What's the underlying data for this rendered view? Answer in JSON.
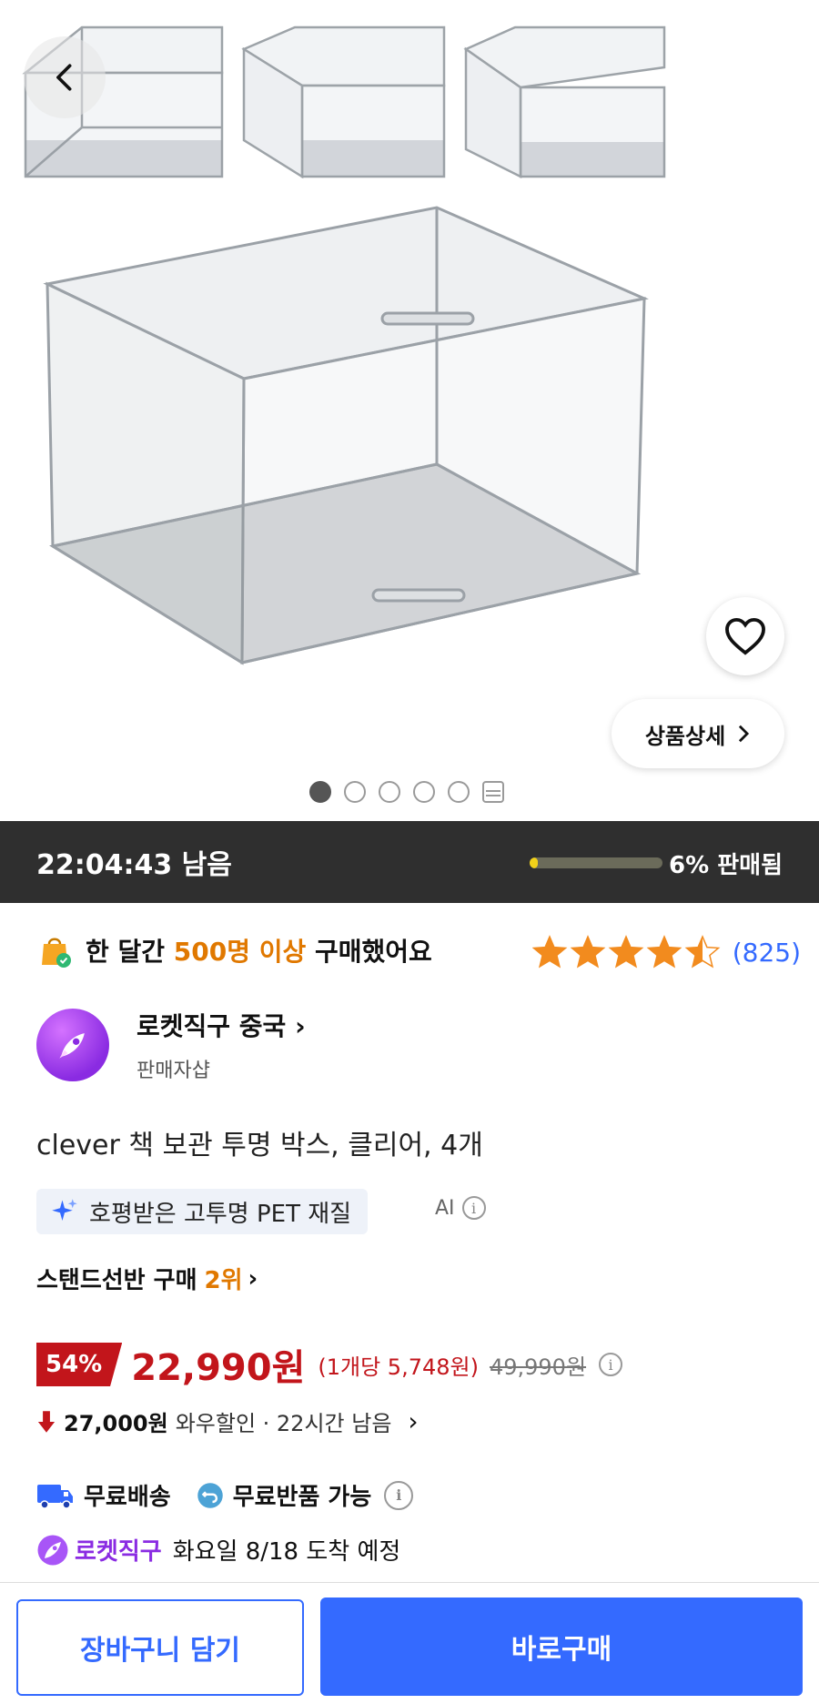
{
  "hero": {
    "back_icon": "chevron-left-icon",
    "wishlist_icon": "heart-icon",
    "detail_label": "상품상세",
    "image_count": 5,
    "active_image": 1
  },
  "timer": {
    "remaining": "22:04:43 남음",
    "sold_fraction": 0.06,
    "sold_label": "6% 판매됨"
  },
  "social_proof": {
    "prefix": "한 달간",
    "highlight": "500명 이상",
    "suffix": "구매했어요"
  },
  "rating": {
    "stars": 4.5,
    "count": "(825)"
  },
  "seller": {
    "name": "로켓직구 중국",
    "sub": "판매자샵"
  },
  "product": {
    "title": "clever 책 보관 투명 박스, 클리어, 4개"
  },
  "ai_summary": {
    "text": "호평받은 고투명 PET 재질",
    "label": "AI"
  },
  "ranking": {
    "text": "스탠드선반 구매",
    "rank": "2위"
  },
  "price": {
    "discount": "54%",
    "sale": "22,990원",
    "unit": "(1개당 5,748원)",
    "original": "49,990원"
  },
  "wow": {
    "amount": "27,000원",
    "rest": "와우할인 · 22시간 남음"
  },
  "shipping": {
    "free_delivery": "무료배송",
    "free_return": "무료반품 가능"
  },
  "rocket": {
    "brand": "로켓직구",
    "eta": "화요일 8/18 도착 예정"
  },
  "actions": {
    "cart": "장바구니 담기",
    "buy": "바로구매"
  },
  "colors": {
    "accent_blue": "#346aff",
    "price_red": "#c2151b",
    "highlight_orange": "#e07800",
    "star": "#f28b1e"
  }
}
